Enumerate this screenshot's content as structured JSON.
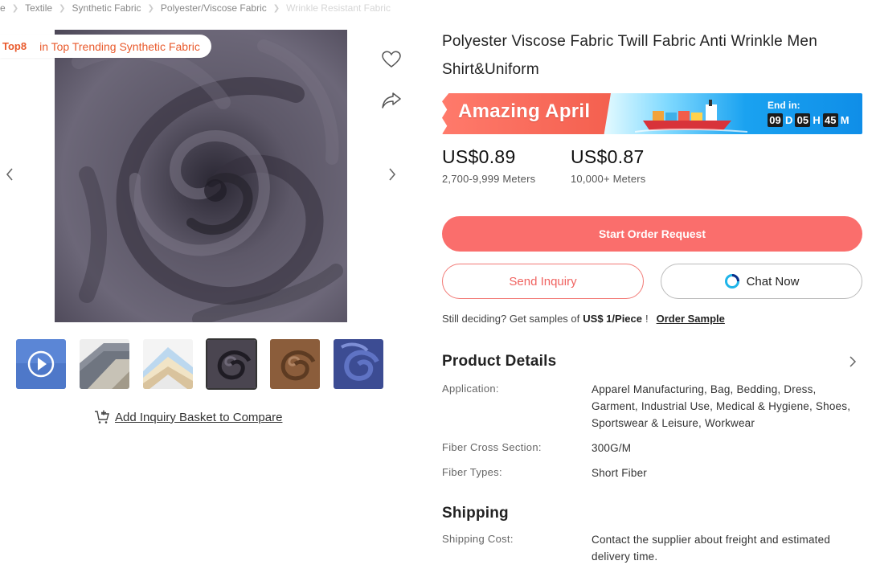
{
  "breadcrumb": [
    "e",
    "Textile",
    "Synthetic Fabric",
    "Polyester/Viscose Fabric",
    "Wrinkle Resistant Fabric"
  ],
  "gallery": {
    "rank_badge": "Top8",
    "rank_text": "in Top Trending Synthetic Fabric",
    "thumbnails": [
      "video",
      "grey-fabric-stack",
      "pastel-fabric-stack",
      "dark-swirl",
      "brown-swirl",
      "blue-swirl"
    ],
    "basket_label": "Add Inquiry Basket to Compare"
  },
  "product": {
    "title": "Polyester Viscose Fabric Twill Fabric Anti Wrinkle Men Shirt&Uniform",
    "promo": {
      "title": "Amazing April",
      "end_label": "End in:",
      "days": "09",
      "days_unit": "D",
      "hours": "05",
      "hours_unit": "H",
      "minutes": "45",
      "minutes_unit": "M"
    },
    "prices": [
      {
        "value": "US$0.89",
        "qty": "2,700-9,999 Meters"
      },
      {
        "value": "US$0.87",
        "qty": "10,000+ Meters"
      }
    ],
    "buttons": {
      "order": "Start Order Request",
      "inquiry": "Send Inquiry",
      "chat": "Chat Now"
    },
    "sample": {
      "text": "Still deciding? Get samples of",
      "price": "US$ 1",
      "unit": "/Piece",
      "bang": "!",
      "link": "Order Sample"
    }
  },
  "details": {
    "title": "Product Details",
    "specs": [
      {
        "label": "Application:",
        "value": "Apparel Manufacturing, Bag, Bedding, Dress, Garment, Industrial Use, Medical & Hygiene, Shoes, Sportswear & Leisure, Workwear"
      },
      {
        "label": "Fiber Cross Section:",
        "value": "300G/M"
      },
      {
        "label": "Fiber Types:",
        "value": "Short Fiber"
      }
    ]
  },
  "shipping": {
    "title": "Shipping",
    "label": "Shipping Cost:",
    "value": "Contact the supplier about freight and estimated delivery time."
  },
  "colors": {
    "accent": "#fa6e6c",
    "rank": "#e95a2c",
    "promo_blue": "#1aa2f0"
  }
}
